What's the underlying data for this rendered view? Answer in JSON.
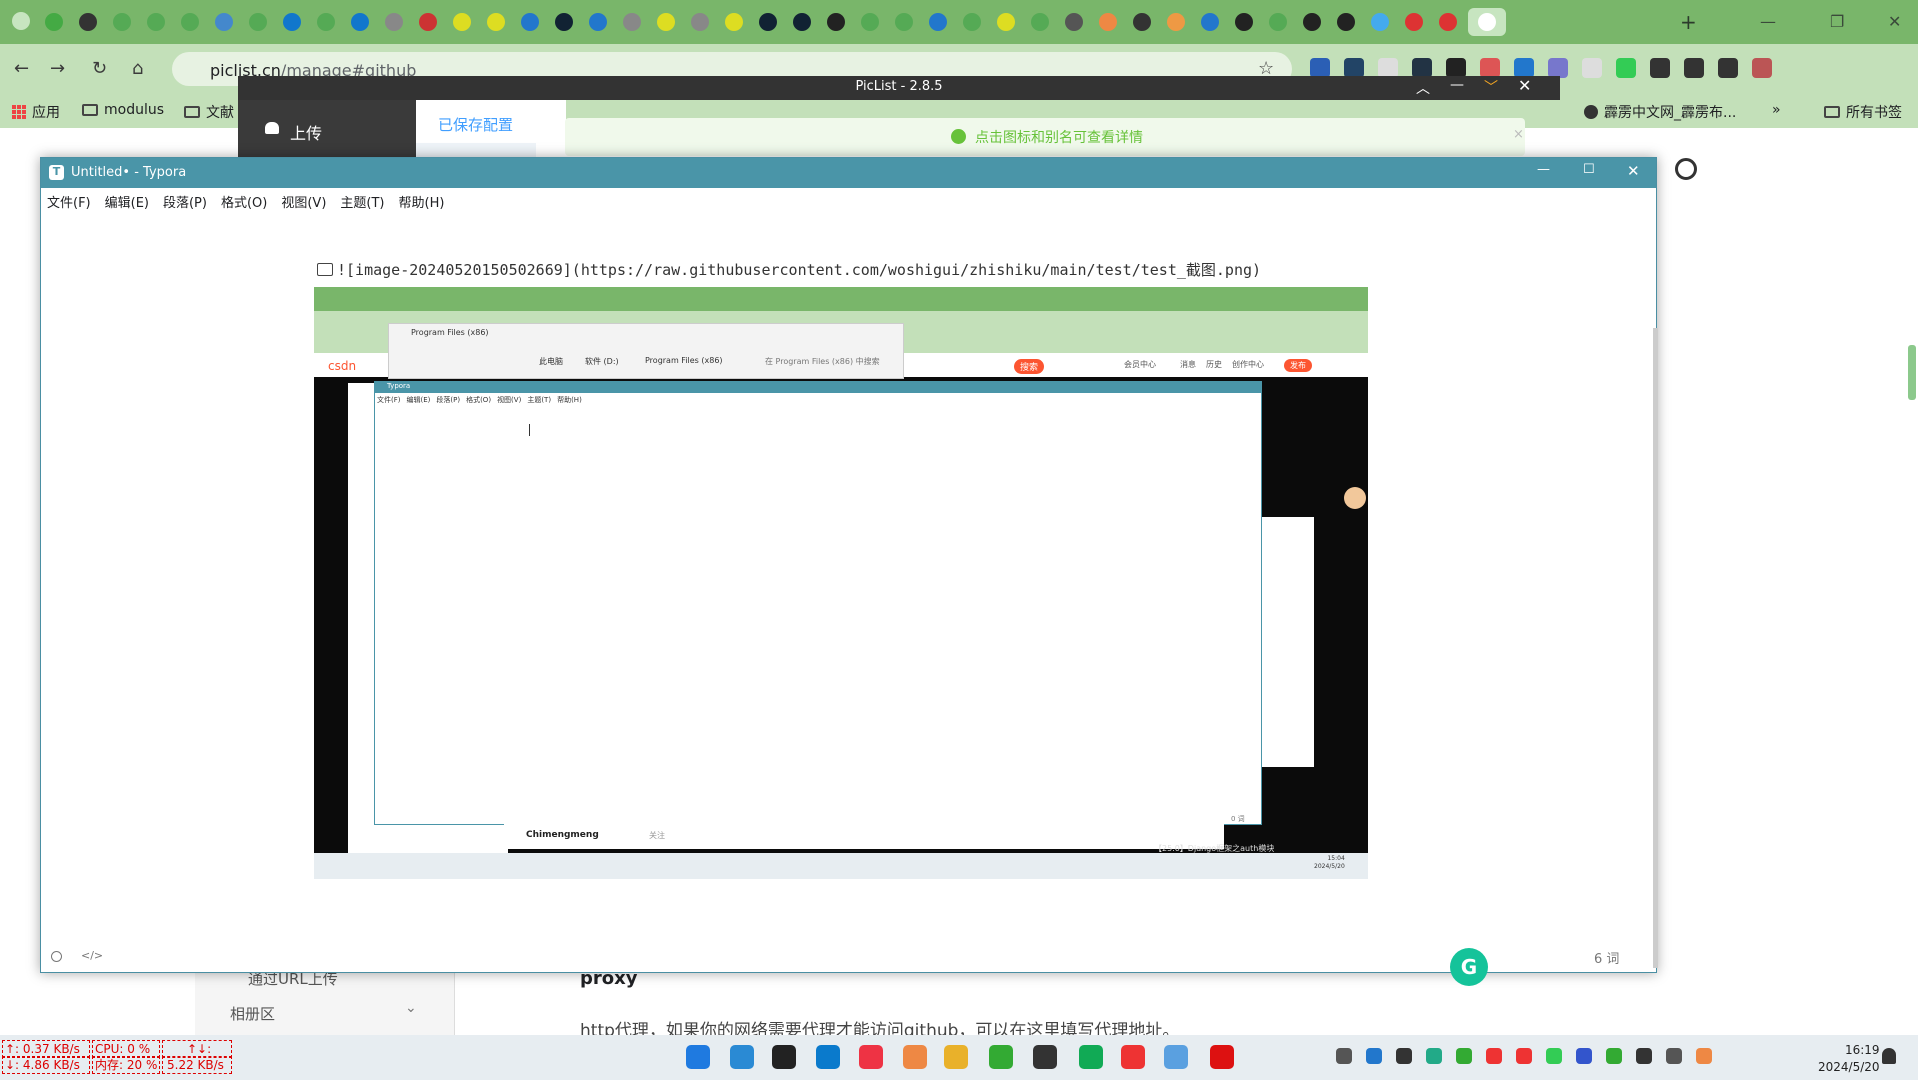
{
  "browser": {
    "tab_bar": {
      "new_tab_symbol": "+",
      "window_controls": [
        "—",
        "❐",
        "✕"
      ]
    },
    "url_host": "piclist.cn",
    "url_path": "/manage#github",
    "bookmarks": [
      {
        "label": "应用"
      },
      {
        "label": "modulus"
      },
      {
        "label": "文献"
      },
      {
        "label": "霹雳中文网_霹雳布..."
      },
      {
        "label": "»"
      },
      {
        "label": "所有书签"
      }
    ],
    "accent_colors": {
      "tab_bar": "#79b66a",
      "omnibox_row": "#c3e0b9"
    }
  },
  "piclist": {
    "title": "PicList - 2.8.5",
    "upload_label": "上传",
    "saved_config_tab": "已保存配置",
    "notice": "点击图标和别名可查看详情",
    "sidebar_items": [
      {
        "label": "通过URL上传"
      },
      {
        "label": "相册区"
      }
    ],
    "proxy_heading": "proxy",
    "proxy_desc": "http代理，如果你的网络需要代理才能访问github，可以在这里填写代理地址。"
  },
  "typora": {
    "title": "Untitled• - Typora",
    "menu": [
      "文件(F)",
      "编辑(E)",
      "段落(P)",
      "格式(O)",
      "视图(V)",
      "主题(T)",
      "帮助(H)"
    ],
    "markdown_line": "![image-20240520150502669](https://raw.githubusercontent.com/woshigui/zhishiku/main/test/test_截图.png)",
    "word_count": "6 词",
    "footer_icons": [
      "circle-icon",
      "code-icon"
    ]
  },
  "embedded_screenshot": {
    "explorer_tab": "Program Files (x86)",
    "explorer_path": [
      "此电脑",
      "软件 (D:)",
      "Program Files (x86)"
    ],
    "explorer_search": "在 Program Files (x86) 中搜索",
    "inner_typora_title": "Typora",
    "inner_menu": [
      "文件(F)",
      "编辑(E)",
      "段落(P)",
      "格式(O)",
      "视图(V)",
      "主题(T)",
      "帮助(H)"
    ],
    "inner_word_count": "0 词",
    "csdn_logo": "csdn",
    "csdn_actions": [
      "搜索",
      "会员中心",
      "消息",
      "历史",
      "创作中心",
      "发布"
    ],
    "author": "Chimengmeng",
    "follow": "关注",
    "article_bottom": "【25.0】Django框架之auth模块",
    "inner_time": "15:04",
    "inner_date": "2024/5/20"
  },
  "taskbar": {
    "net_up": "↑: 0.37 KB/s",
    "net_down": "↓: 4.86 KB/s",
    "cpu": "CPU: 0 %",
    "mem": "内存: 20 %",
    "rate_up": "↑↓:",
    "rate_down": "5.22 KB/s",
    "time": "16:19",
    "date": "2024/5/20"
  }
}
